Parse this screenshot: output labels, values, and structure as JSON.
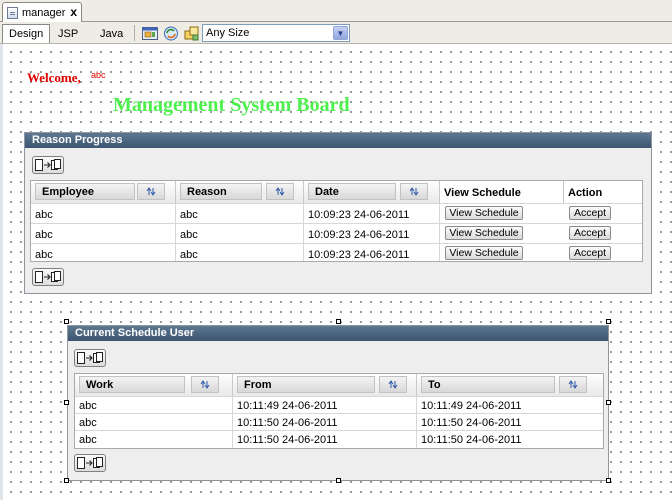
{
  "editor": {
    "file_tab": "manager",
    "close_glyph": "x",
    "view_tabs": [
      "Design",
      "JSP",
      "Java"
    ],
    "size_select": "Any Size"
  },
  "icons": {
    "file": "file-icon",
    "close": "close-icon",
    "toolbar": [
      "preview-browser-icon",
      "refresh-icon",
      "component-layout-icon"
    ],
    "dropdown": "chevron-down-icon",
    "export": "export-table-icon",
    "sort": "sort-arrows-icon"
  },
  "page": {
    "welcome": "Welcome,",
    "user": "abc",
    "title": "Management System Board"
  },
  "reason_panel": {
    "title": "Reason Progress",
    "columns": {
      "employee": "Employee",
      "reason": "Reason",
      "date": "Date",
      "view_schedule": "View Schedule",
      "action": "Action"
    },
    "rows": [
      {
        "employee": "abc",
        "reason": "abc",
        "date": "10:09:23 24-06-2011",
        "view_button": "View Schedule",
        "action_button": "Accept"
      },
      {
        "employee": "abc",
        "reason": "abc",
        "date": "10:09:23 24-06-2011",
        "view_button": "View Schedule",
        "action_button": "Accept"
      },
      {
        "employee": "abc",
        "reason": "abc",
        "date": "10:09:23 24-06-2011",
        "view_button": "View Schedule",
        "action_button": "Accept"
      }
    ]
  },
  "schedule_panel": {
    "title": "Current Schedule User",
    "columns": {
      "work": "Work",
      "from": "From",
      "to": "To"
    },
    "rows": [
      {
        "work": "abc",
        "from": "10:11:49 24-06-2011",
        "to": "10:11:49 24-06-2011"
      },
      {
        "work": "abc",
        "from": "10:11:50 24-06-2011",
        "to": "10:11:50 24-06-2011"
      },
      {
        "work": "abc",
        "from": "10:11:50 24-06-2011",
        "to": "10:11:50 24-06-2011"
      }
    ]
  },
  "colors": {
    "welcome": "#e00000",
    "title": "#4ef04e",
    "panel_header": "#4a6580"
  }
}
